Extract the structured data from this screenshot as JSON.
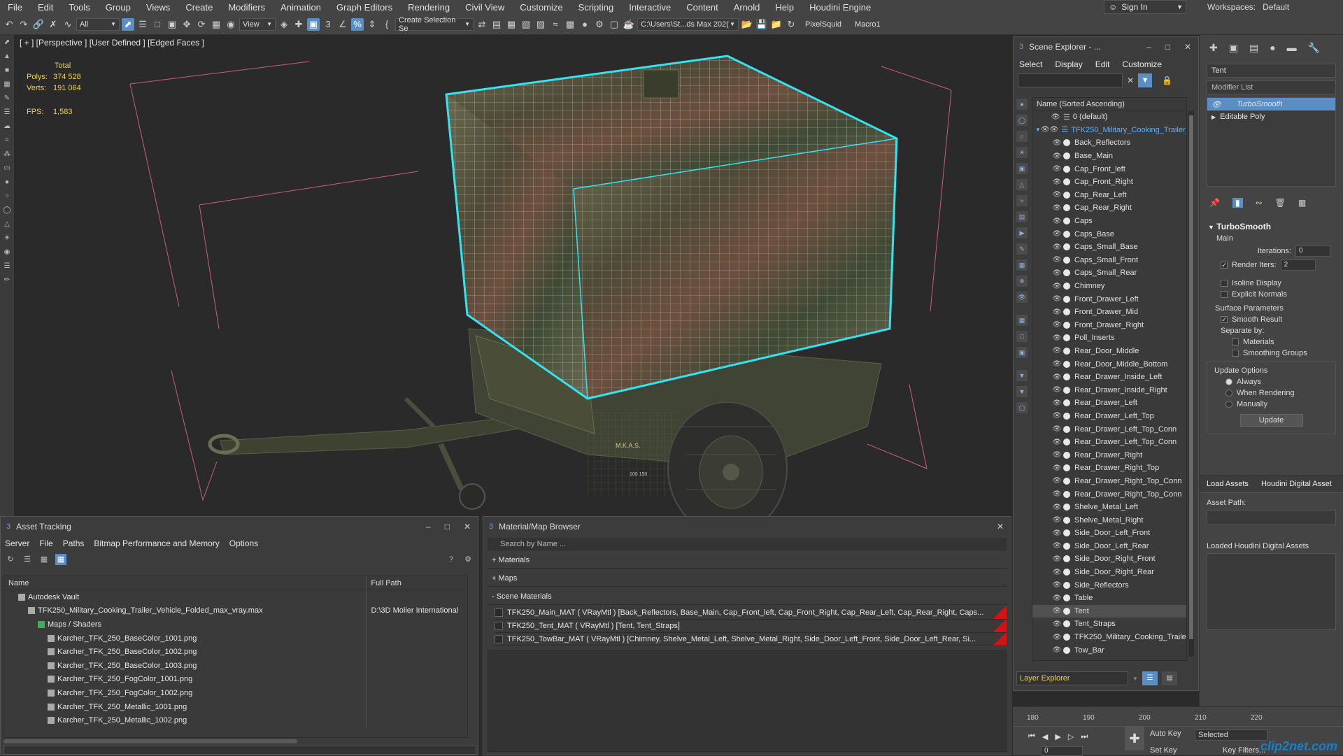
{
  "menu": [
    "File",
    "Edit",
    "Tools",
    "Group",
    "Views",
    "Create",
    "Modifiers",
    "Animation",
    "Graph Editors",
    "Rendering",
    "Civil View",
    "Customize",
    "Scripting",
    "Interactive",
    "Content",
    "Arnold",
    "Help",
    "Houdini Engine"
  ],
  "signin": "Sign In",
  "workspaces_label": "Workspaces:",
  "workspaces_value": "Default",
  "toolbar": {
    "filter": "All",
    "view": "View",
    "selection_set": "Create Selection Se",
    "path": "C:\\Users\\St...ds Max 202(",
    "pixelsquid": "PixelSquid",
    "macro": "Macro1"
  },
  "viewport": {
    "label": "[ + ] [Perspective ] [User Defined ] [Edged Faces ]",
    "total_label": "Total",
    "polys_label": "Polys:",
    "polys": "374 528",
    "verts_label": "Verts:",
    "verts": "191 064",
    "fps_label": "FPS:",
    "fps": "1,583",
    "trailer_labels": [
      "M.K.A.S.",
      "100 150"
    ]
  },
  "scene_explorer": {
    "title": "Scene Explorer - ...",
    "menu": [
      "Select",
      "Display",
      "Edit",
      "Customize"
    ],
    "column": "Name (Sorted Ascending)",
    "default_layer": "0 (default)",
    "root": "TFK250_Military_Cooking_Trailer_V",
    "items": [
      "Back_Reflectors",
      "Base_Main",
      "Cap_Front_left",
      "Cap_Front_Right",
      "Cap_Rear_Left",
      "Cap_Rear_Right",
      "Caps",
      "Caps_Base",
      "Caps_Small_Base",
      "Caps_Small_Front",
      "Caps_Small_Rear",
      "Chimney",
      "Front_Drawer_Left",
      "Front_Drawer_Mid",
      "Front_Drawer_Right",
      "Poll_Inserts",
      "Rear_Door_Middle",
      "Rear_Door_Middle_Bottom",
      "Rear_Drawer_Inside_Left",
      "Rear_Drawer_Inside_Right",
      "Rear_Drawer_Left",
      "Rear_Drawer_Left_Top",
      "Rear_Drawer_Left_Top_Conn",
      "Rear_Drawer_Left_Top_Conn",
      "Rear_Drawer_Right",
      "Rear_Drawer_Right_Top",
      "Rear_Drawer_Right_Top_Conn",
      "Rear_Drawer_Right_Top_Conn",
      "Shelve_Metal_Left",
      "Shelve_Metal_Right",
      "Side_Door_Left_Front",
      "Side_Door_Left_Rear",
      "Side_Door_Right_Front",
      "Side_Door_Right_Rear",
      "Side_Reflectors",
      "Table",
      "Tent",
      "Tent_Straps",
      "TFK250_Military_Cooking_Traile",
      "Tow_Bar"
    ],
    "selected_item": "Tent",
    "layer_explorer": "Layer Explorer"
  },
  "command_panel": {
    "object_name": "Tent",
    "modifier_list": "Modifier List",
    "stack": [
      "TurboSmooth",
      "Editable Poly"
    ],
    "turbosmooth_title": "TurboSmooth",
    "main_label": "Main",
    "iterations_label": "Iterations:",
    "iterations": "0",
    "render_iters_label": "Render Iters:",
    "render_iters": "2",
    "isoline": "Isoline Display",
    "explicit_normals": "Explicit Normals",
    "surface_params": "Surface Parameters",
    "smooth_result": "Smooth Result",
    "separate_by": "Separate by:",
    "materials": "Materials",
    "smoothing_groups": "Smoothing Groups",
    "update_options": "Update Options",
    "always": "Always",
    "when_rendering": "When Rendering",
    "manually": "Manually",
    "update_btn": "Update",
    "load_assets_tab": "Load Assets",
    "houdini_tab": "Houdini Digital Asset",
    "asset_path_label": "Asset Path:",
    "loaded_hda_label": "Loaded Houdini Digital Assets"
  },
  "asset_tracking": {
    "title": "Asset Tracking",
    "menu": [
      "Server",
      "File",
      "Paths",
      "Bitmap Performance and Memory",
      "Options"
    ],
    "col_name": "Name",
    "col_path": "Full Path",
    "rows": [
      {
        "name": "Autodesk Vault",
        "path": "",
        "indent": 1
      },
      {
        "name": "TFK250_Military_Cooking_Trailer_Vehicle_Folded_max_vray.max",
        "path": "D:\\3D Molier International",
        "indent": 2
      },
      {
        "name": "Maps / Shaders",
        "path": "",
        "indent": 3
      },
      {
        "name": "Karcher_TFK_250_BaseColor_1001.png",
        "path": "",
        "indent": 4
      },
      {
        "name": "Karcher_TFK_250_BaseColor_1002.png",
        "path": "",
        "indent": 4
      },
      {
        "name": "Karcher_TFK_250_BaseColor_1003.png",
        "path": "",
        "indent": 4
      },
      {
        "name": "Karcher_TFK_250_FogColor_1001.png",
        "path": "",
        "indent": 4
      },
      {
        "name": "Karcher_TFK_250_FogColor_1002.png",
        "path": "",
        "indent": 4
      },
      {
        "name": "Karcher_TFK_250_Metallic_1001.png",
        "path": "",
        "indent": 4
      },
      {
        "name": "Karcher_TFK_250_Metallic_1002.png",
        "path": "",
        "indent": 4
      }
    ]
  },
  "material_browser": {
    "title": "Material/Map Browser",
    "search_placeholder": "Search by Name ...",
    "sections": [
      "+ Materials",
      "+ Maps",
      "- Scene Materials"
    ],
    "materials": [
      "TFK250_Main_MAT ( VRayMtl ) [Back_Reflectors, Base_Main, Cap_Front_left, Cap_Front_Right, Cap_Rear_Left, Cap_Rear_Right, Caps...",
      "TFK250_Tent_MAT ( VRayMtl ) [Tent, Tent_Straps]",
      "TFK250_TowBar_MAT ( VRayMtl ) [Chimney, Shelve_Metal_Left, Shelve_Metal_Right, Side_Door_Left_Front, Side_Door_Left_Rear, Si..."
    ]
  },
  "timeline": {
    "ticks": [
      "180",
      "190",
      "200",
      "210",
      "220"
    ],
    "frame": "0",
    "auto_key": "Auto Key",
    "set_key": "Set Key",
    "selected": "Selected",
    "key_filters": "Key Filters...",
    "watermark": "clip2net.com"
  }
}
